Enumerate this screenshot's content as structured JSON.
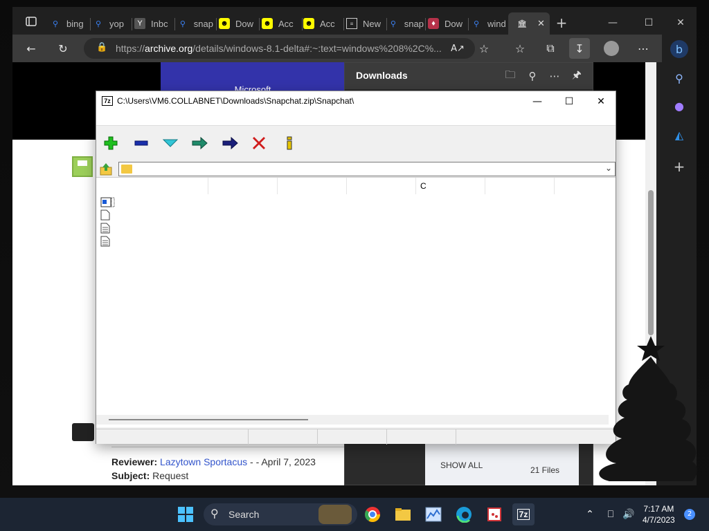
{
  "browser": {
    "tabs": [
      {
        "label": "bing",
        "icon": "search-icon"
      },
      {
        "label": "yop",
        "icon": "search-icon"
      },
      {
        "label": "Inbc",
        "icon": "yahoo-icon"
      },
      {
        "label": "snap",
        "icon": "search-icon"
      },
      {
        "label": "Dow",
        "icon": "snapchat-icon"
      },
      {
        "label": "Acc",
        "icon": "snapchat-icon"
      },
      {
        "label": "Acc",
        "icon": "snapchat-icon"
      },
      {
        "label": "New",
        "icon": "page-icon"
      },
      {
        "label": "snap",
        "icon": "search-icon"
      },
      {
        "label": "Dow",
        "icon": "shield-icon"
      },
      {
        "label": "wind",
        "icon": "search-icon"
      }
    ],
    "url_prefix": "https://",
    "url_host": "archive.org",
    "url_rest": "/details/windows-8.1-delta#:~:text=windows%208%2C%..."
  },
  "page": {
    "banner": "Microsoft",
    "reviewer_label": "Reviewer:",
    "reviewer_name": "Lazytown Sportacus",
    "reviewer_date": " - - April 7, 2023",
    "subject_label": "Subject:",
    "subject_value": "Request"
  },
  "downloads": {
    "title": "Downloads",
    "show_all": "SHOW ALL",
    "files": "21 Files"
  },
  "sevenzip": {
    "logo": "7z",
    "path": "C:\\Users\\VM6.COLLABNET\\Downloads\\Snapchat.zip\\Snapchat\\",
    "column_c": "C",
    "tools": [
      "add-icon",
      "extract-icon",
      "test-icon",
      "copy-icon",
      "move-icon",
      "delete-icon",
      "info-icon"
    ]
  },
  "taskbar": {
    "search": "Search",
    "time": "7:17 AM",
    "date": "4/7/2023",
    "notifications": "2"
  },
  "colors": {
    "accent": "#3333aa",
    "taskbar": "#1c2533",
    "link": "#3355cc"
  }
}
